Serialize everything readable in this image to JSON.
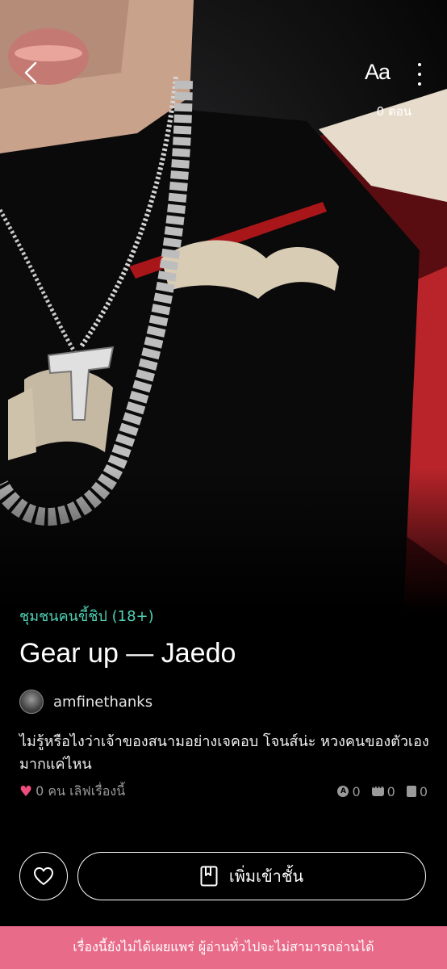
{
  "header": {
    "font_button_label": "Aa",
    "chapter_count": "0 ตอน"
  },
  "story": {
    "community": "ชุมชนคนขี้ชิป (18+)",
    "title": "Gear up — Jaedo",
    "author": "amfinethanks",
    "description": "ไม่รู้หรือไงว่าเจ้าของสนามอย่างเจคอบ โจนส์น่ะ หวงคนของตัวเองมากแค่ไหน",
    "likes_text": "0 คน เลิฟเรื่องนี้",
    "counters": {
      "a": "0",
      "comments": "0",
      "books": "0"
    }
  },
  "actions": {
    "add_label": "เพิ่มเข้าชั้น"
  },
  "notice": "เรื่องนี้ยังไม่ได้เผยแพร่ ผู้อ่านทั่วไปจะไม่สามารถอ่านได้",
  "colors": {
    "accent_teal": "#4fd1b5",
    "heart": "#ec4d7c",
    "notice_bg": "#e86b89"
  },
  "icons": [
    "back-chevron-icon",
    "more-vertical-icon",
    "heart-icon",
    "a-badge-icon",
    "comment-icon",
    "book-icon",
    "bookmark-icon"
  ]
}
